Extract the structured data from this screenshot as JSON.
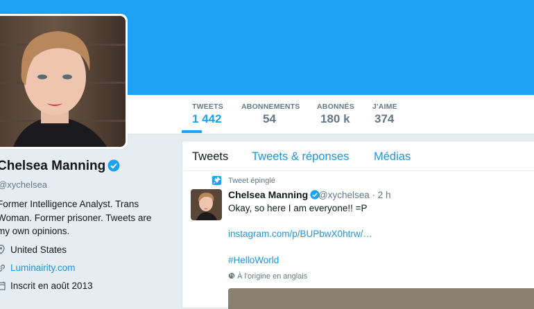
{
  "colors": {
    "accent": "#1da1f2",
    "link": "#1b95e0",
    "muted": "#657786"
  },
  "stats": [
    {
      "label": "TWEETS",
      "value": "1 442",
      "active": true
    },
    {
      "label": "ABONNEMENTS",
      "value": "54",
      "active": false
    },
    {
      "label": "ABONNÉS",
      "value": "180 k",
      "active": false
    },
    {
      "label": "J'AIME",
      "value": "374",
      "active": false
    }
  ],
  "profile": {
    "name": "Chelsea Manning",
    "handle": "@xychelsea",
    "bio": "Former Intelligence Analyst. Trans Woman. Former prisoner. Tweets are my own opinions.",
    "location": "United States",
    "website": "Luminairity.com",
    "joined": "Inscrit en août 2013"
  },
  "tabs": [
    "Tweets",
    "Tweets & réponses",
    "Médias"
  ],
  "tweet": {
    "pinned_label": "Tweet épinglé",
    "name": "Chelsea Manning",
    "handle_time": "@xychelsea · 2 h",
    "text": "Okay, so here I am everyone!! =P",
    "link": "instagram.com/p/BUPbwX0htrw/…",
    "hashtag": "#HelloWorld",
    "origin": "À l'origine en anglais"
  },
  "icons": {
    "location": "map-pin-icon",
    "website": "link-icon",
    "joined": "calendar-icon",
    "pinned": "pin-icon",
    "verified": "verified-badge-icon",
    "globe": "globe-icon"
  }
}
